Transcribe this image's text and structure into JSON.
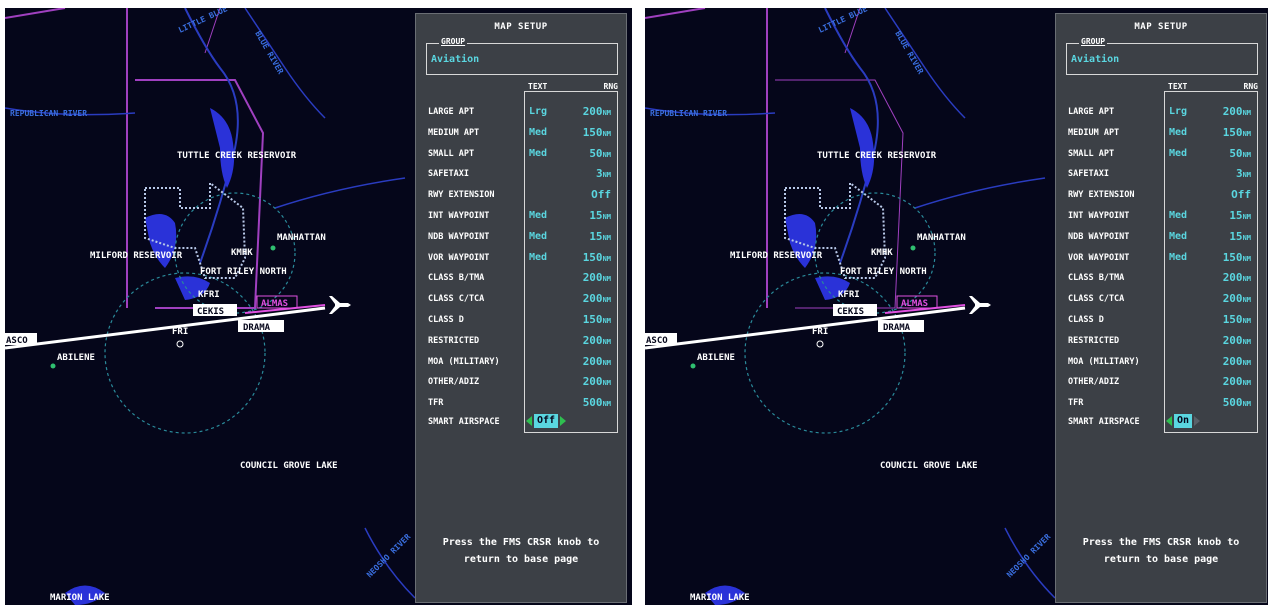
{
  "panel": {
    "title": "MAP SETUP",
    "group_label": "GROUP",
    "group_value": "Aviation",
    "col_text": "TEXT",
    "col_rng": "RNG",
    "rows": [
      {
        "label": "LARGE APT",
        "text": "Lrg",
        "rng": "200",
        "unit": "NM"
      },
      {
        "label": "MEDIUM APT",
        "text": "Med",
        "rng": "150",
        "unit": "NM"
      },
      {
        "label": "SMALL APT",
        "text": "Med",
        "rng": "50",
        "unit": "NM"
      },
      {
        "label": "SAFETAXI",
        "text": "",
        "rng": "3",
        "unit": "NM"
      },
      {
        "label": "RWY EXTENSION",
        "text": "",
        "rng": "Off",
        "unit": ""
      },
      {
        "label": "INT WAYPOINT",
        "text": "Med",
        "rng": "15",
        "unit": "NM"
      },
      {
        "label": "NDB WAYPOINT",
        "text": "Med",
        "rng": "15",
        "unit": "NM"
      },
      {
        "label": "VOR WAYPOINT",
        "text": "Med",
        "rng": "150",
        "unit": "NM"
      },
      {
        "label": "CLASS B/TMA",
        "text": "",
        "rng": "200",
        "unit": "NM"
      },
      {
        "label": "CLASS C/TCA",
        "text": "",
        "rng": "200",
        "unit": "NM"
      },
      {
        "label": "CLASS D",
        "text": "",
        "rng": "150",
        "unit": "NM"
      },
      {
        "label": "RESTRICTED",
        "text": "",
        "rng": "200",
        "unit": "NM"
      },
      {
        "label": "MOA (MILITARY)",
        "text": "",
        "rng": "200",
        "unit": "NM"
      },
      {
        "label": "OTHER/ADIZ",
        "text": "",
        "rng": "200",
        "unit": "NM"
      },
      {
        "label": "TFR",
        "text": "",
        "rng": "500",
        "unit": "NM"
      }
    ],
    "smart_airspace_label": "SMART AIRSPACE",
    "message_line1": "Press the FMS CRSR knob to",
    "message_line2": "return to base page"
  },
  "left": {
    "smart_airspace_value": "Off"
  },
  "right": {
    "smart_airspace_value": "On"
  },
  "map": {
    "little_blue": "LITTLE BLUE",
    "blue_river": "BLUE RIVER",
    "republican_river": "REPUBLICAN RIVER",
    "tuttle_creek": "TUTTLE CREEK RESERVOIR",
    "manhattan": "MANHATTAN",
    "kmhk": "KMHK",
    "milford": "MILFORD RESERVOIR",
    "fort_riley": "FORT RILEY NORTH",
    "kfri": "KFRI",
    "cekis": "CEKIS",
    "almas": "ALMAS",
    "drama": "DRAMA",
    "fri": "FRI",
    "asco": "ASCO",
    "abilene": "ABILENE",
    "council_grove": "COUNCIL GROVE LAKE",
    "neosho_river": "NEOSHO RIVER",
    "marion_lake": "MARION LAKE"
  },
  "colors": {
    "background": "#05061a",
    "panel": "#3c4046",
    "cyan_value": "#5ad6e0",
    "airspace": "#a040c0",
    "water": "#2a32d8"
  }
}
